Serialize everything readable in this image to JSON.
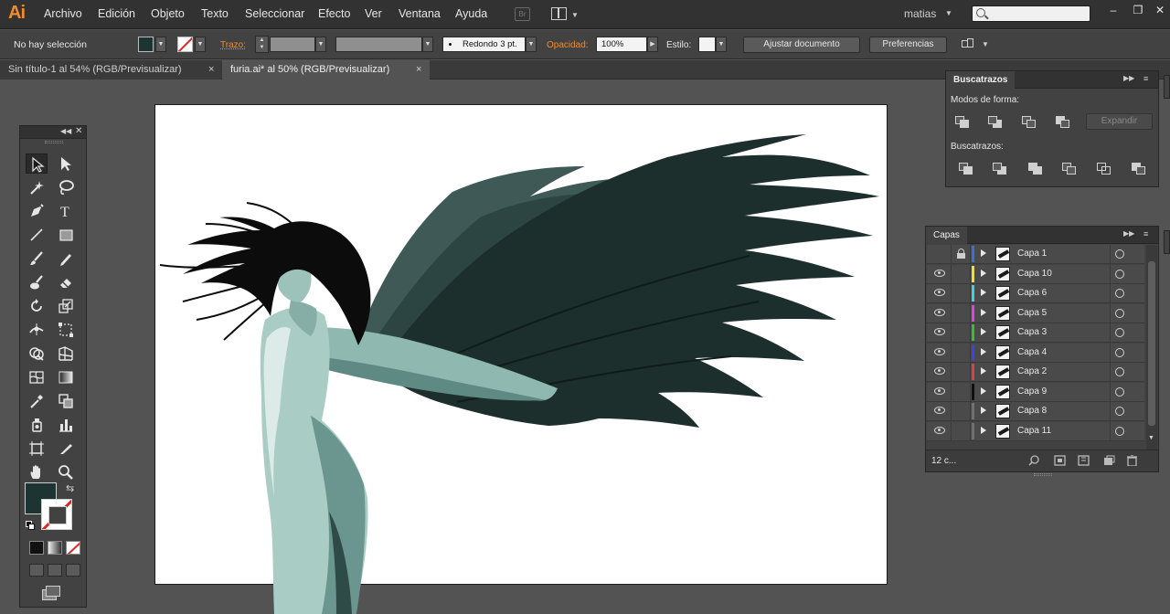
{
  "menubar": {
    "app_logo": "Ai",
    "items": [
      "Archivo",
      "Edición",
      "Objeto",
      "Texto",
      "Seleccionar",
      "Efecto",
      "Ver",
      "Ventana",
      "Ayuda"
    ],
    "bridge_label": "Br",
    "user": "matias",
    "window_controls": [
      "–",
      "❐",
      "✕"
    ]
  },
  "controlbar": {
    "selection_status": "No hay selección",
    "stroke_label": "Trazo:",
    "brush_label": "Redondo 3 pt.",
    "opacity_label": "Opacidad:",
    "opacity_value": "100%",
    "style_label": "Estilo:",
    "adjust_doc_button": "Ajustar documento",
    "preferences_button": "Preferencias"
  },
  "tabs": [
    {
      "label": "Sin título-1 al 54% (RGB/Previsualizar)",
      "close": "×",
      "active": false
    },
    {
      "label": "furia.ai* al 50% (RGB/Previsualizar)",
      "close": "×",
      "active": true
    }
  ],
  "colors": {
    "fill": "#1e3432",
    "stroke_none": "#e0261f",
    "accent_orange": "#f08c2a"
  },
  "tools": [
    "selection-tool",
    "direct-selection-tool",
    "magic-wand-tool",
    "lasso-tool",
    "pen-tool",
    "type-tool",
    "line-tool",
    "rectangle-tool",
    "paintbrush-tool",
    "pencil-tool",
    "blob-brush-tool",
    "eraser-tool",
    "rotate-tool",
    "scale-tool",
    "width-tool",
    "free-transform-tool",
    "shape-builder-tool",
    "perspective-grid-tool",
    "mesh-tool",
    "gradient-tool",
    "eyedropper-tool",
    "blend-tool",
    "symbol-sprayer-tool",
    "column-graph-tool",
    "artboard-tool",
    "slice-tool",
    "hand-tool",
    "zoom-tool"
  ],
  "pathfinder": {
    "title": "Buscatrazos",
    "shape_modes_label": "Modos de forma:",
    "expand_button": "Expandir",
    "pathfinders_label": "Buscatrazos:"
  },
  "layers": {
    "title": "Capas",
    "count_label": "12 c...",
    "rows": [
      {
        "name": "Capa 1",
        "color": "#3a6ed8",
        "locked": true,
        "visible": false
      },
      {
        "name": "Capa 10",
        "color": "#f0e020",
        "locked": false,
        "visible": true
      },
      {
        "name": "Capa 6",
        "color": "#40d0e0",
        "locked": false,
        "visible": true
      },
      {
        "name": "Capa 5",
        "color": "#e040e0",
        "locked": false,
        "visible": true
      },
      {
        "name": "Capa 3",
        "color": "#30c030",
        "locked": false,
        "visible": true
      },
      {
        "name": "Capa 4",
        "color": "#4040e8",
        "locked": false,
        "visible": true
      },
      {
        "name": "Capa 2",
        "color": "#e04040",
        "locked": false,
        "visible": true
      },
      {
        "name": "Capa 9",
        "color": "#101010",
        "locked": false,
        "visible": true
      },
      {
        "name": "Capa 8",
        "color": "#707070",
        "locked": false,
        "visible": true
      },
      {
        "name": "Capa 11",
        "color": "#707070",
        "locked": false,
        "visible": true
      }
    ]
  }
}
